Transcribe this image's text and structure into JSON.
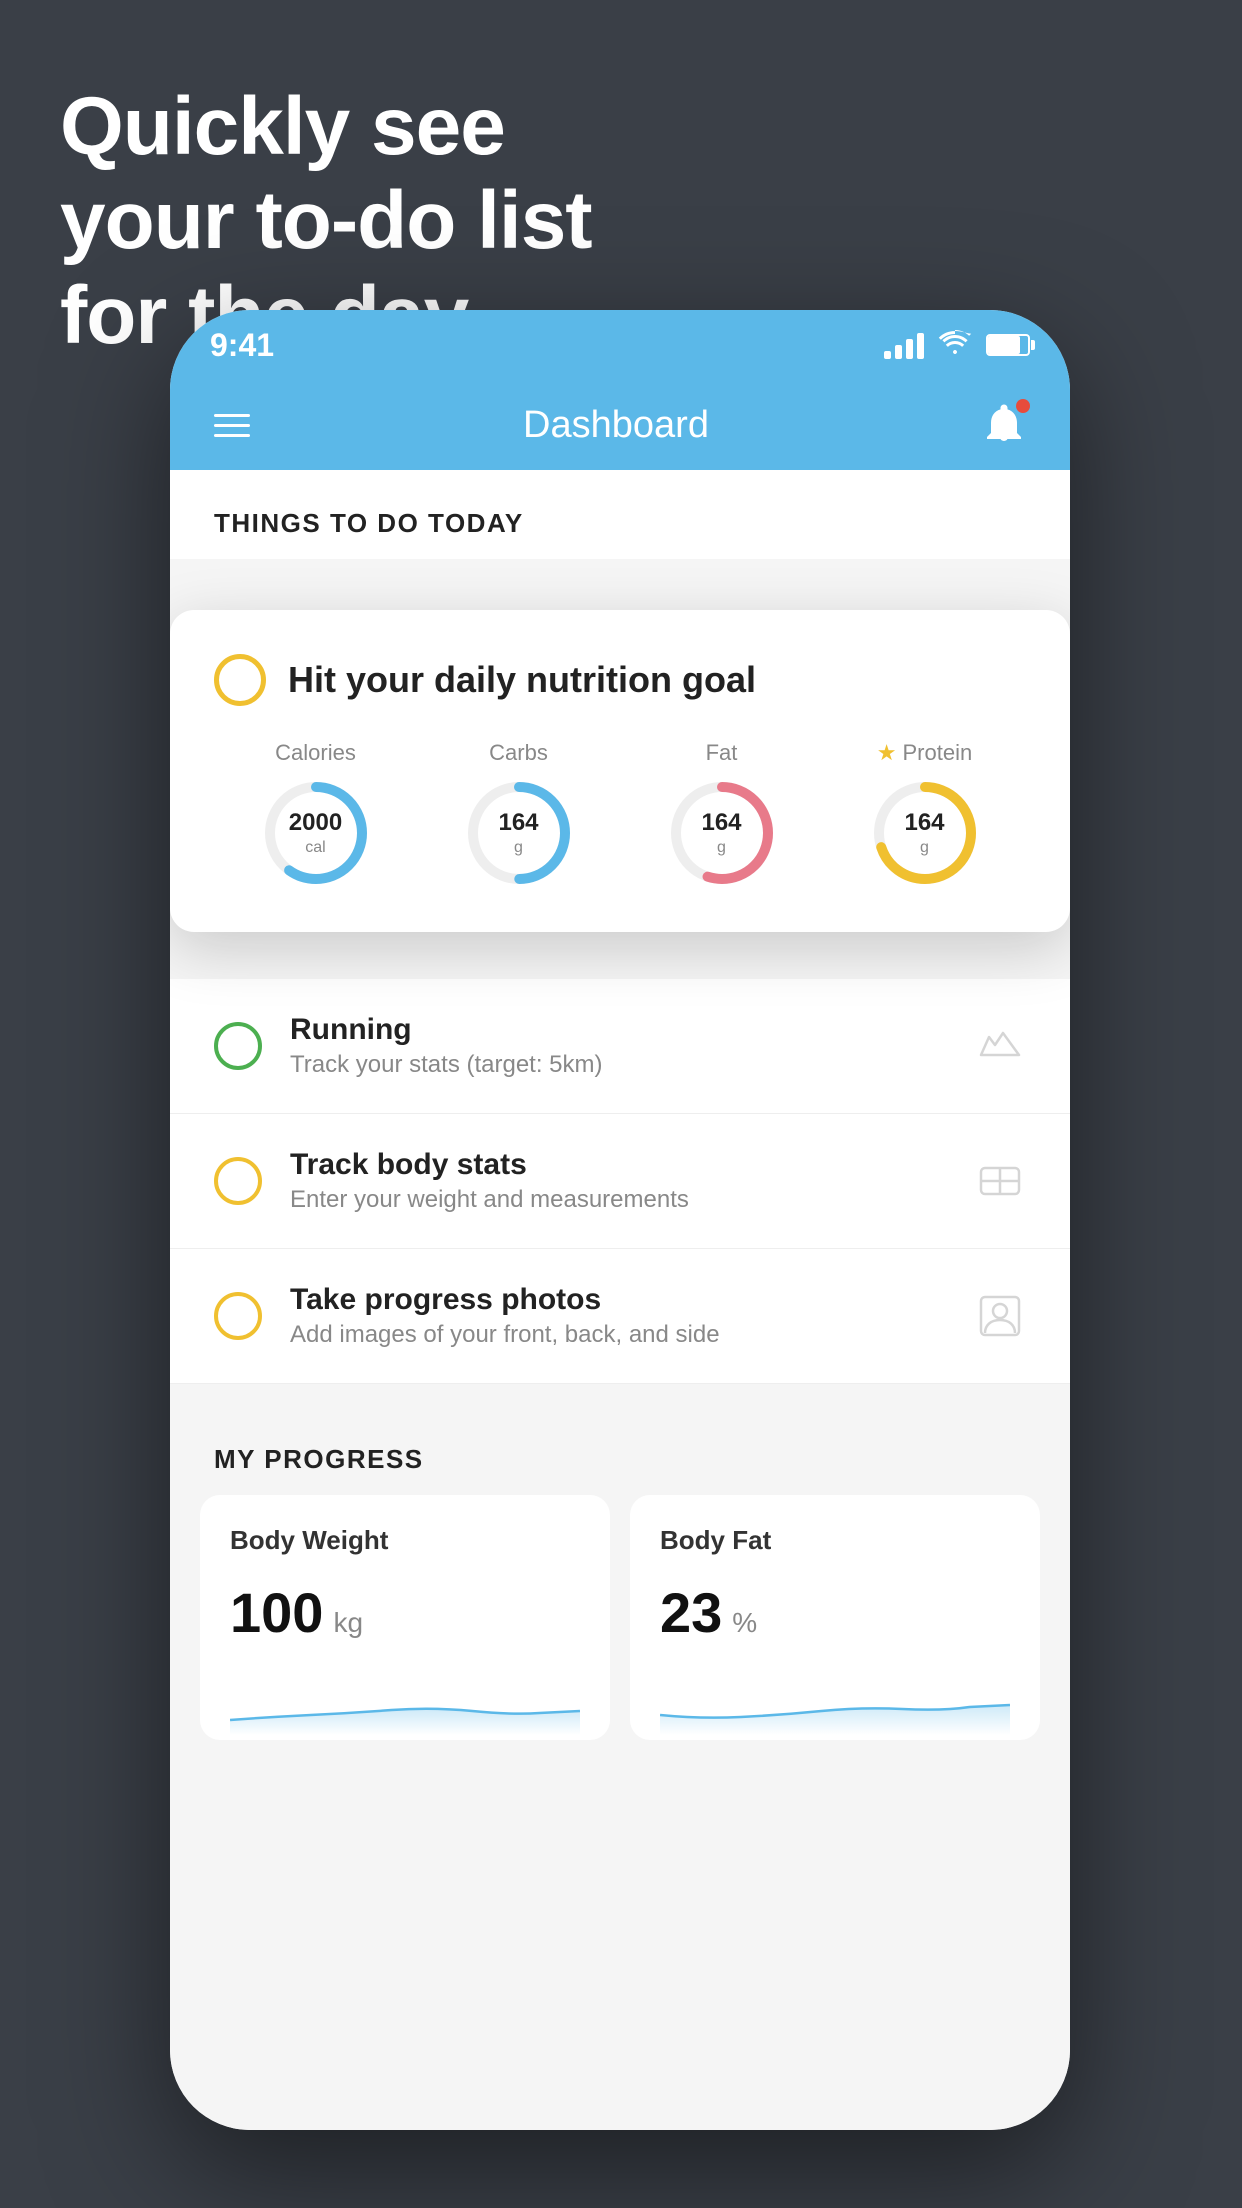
{
  "headline": {
    "line1": "Quickly see",
    "line2": "your to-do list",
    "line3": "for the day."
  },
  "status_bar": {
    "time": "9:41"
  },
  "nav": {
    "title": "Dashboard"
  },
  "things_section": {
    "title": "THINGS TO DO TODAY"
  },
  "nutrition_card": {
    "title": "Hit your daily nutrition goal",
    "macros": [
      {
        "label": "Calories",
        "value": "2000",
        "unit": "cal",
        "color": "#5bb8e8",
        "progress": 0.6
      },
      {
        "label": "Carbs",
        "value": "164",
        "unit": "g",
        "color": "#5bb8e8",
        "progress": 0.5
      },
      {
        "label": "Fat",
        "value": "164",
        "unit": "g",
        "color": "#e87a8a",
        "progress": 0.55
      },
      {
        "label": "Protein",
        "value": "164",
        "unit": "g",
        "color": "#f0c030",
        "progress": 0.7,
        "starred": true
      }
    ]
  },
  "todo_items": [
    {
      "title": "Running",
      "subtitle": "Track your stats (target: 5km)",
      "circle_color": "green",
      "icon": "shoe"
    },
    {
      "title": "Track body stats",
      "subtitle": "Enter your weight and measurements",
      "circle_color": "yellow",
      "icon": "scale"
    },
    {
      "title": "Take progress photos",
      "subtitle": "Add images of your front, back, and side",
      "circle_color": "yellow",
      "icon": "person"
    }
  ],
  "progress_section": {
    "title": "MY PROGRESS",
    "cards": [
      {
        "title": "Body Weight",
        "value": "100",
        "unit": "kg"
      },
      {
        "title": "Body Fat",
        "value": "23",
        "unit": "%"
      }
    ]
  }
}
